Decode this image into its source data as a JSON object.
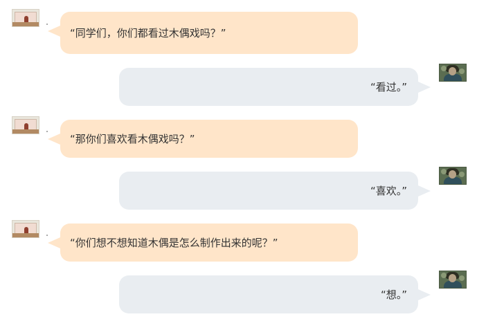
{
  "messages": [
    {
      "speaker": "teacher",
      "text": "“同学们，你们都看过木偶戏吗？”"
    },
    {
      "speaker": "student",
      "text": "“看过。”"
    },
    {
      "speaker": "teacher",
      "text": "“那你们喜欢看木偶戏吗？”"
    },
    {
      "speaker": "student",
      "text": "“喜欢。”"
    },
    {
      "speaker": "teacher",
      "text": "“你们想不想知道木偶是怎么制作出来的呢？”"
    },
    {
      "speaker": "student",
      "text": "“想。”"
    }
  ],
  "colors": {
    "teacher_bubble": "#ffe5c9",
    "student_bubble": "#e9edf1",
    "text": "#333333"
  }
}
